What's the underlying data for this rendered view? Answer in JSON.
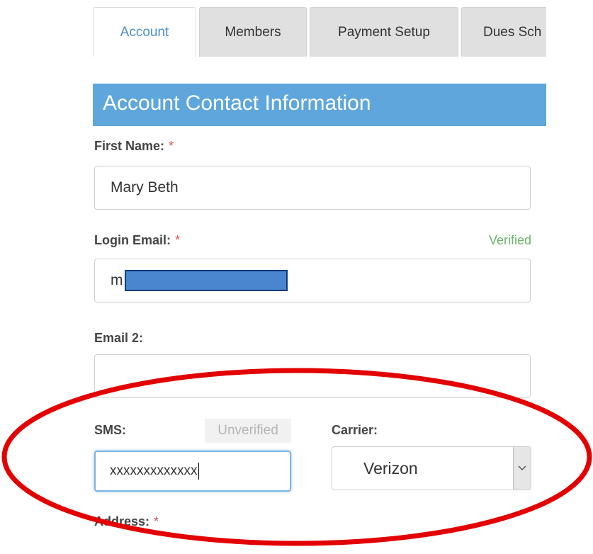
{
  "tabs": [
    {
      "label": "Account",
      "active": true
    },
    {
      "label": "Members",
      "active": false
    },
    {
      "label": "Payment Setup",
      "active": false
    },
    {
      "label": "Dues Sch",
      "active": false
    }
  ],
  "section": {
    "title": "Account Contact Information"
  },
  "form": {
    "first_name": {
      "label": "First Name:",
      "required_mark": "*",
      "value": "Mary Beth"
    },
    "login_email": {
      "label": "Login Email:",
      "required_mark": "*",
      "status": "Verified",
      "value_prefix": "m"
    },
    "email2": {
      "label": "Email 2:",
      "value": ""
    },
    "sms": {
      "label": "SMS:",
      "status": "Unverified",
      "value": "xxxxxxxxxxxxx"
    },
    "carrier": {
      "label": "Carrier:",
      "selected": "Verizon"
    },
    "address": {
      "label": "Address:",
      "required_mark": "*"
    }
  },
  "colors": {
    "accent": "#5ea6db",
    "tab_active_text": "#4a8fc8",
    "verified": "#6bb36b",
    "required": "#d9534f",
    "annotation": "#e30000"
  },
  "icons": {
    "carrier_dropdown": "chevron-down-icon"
  }
}
